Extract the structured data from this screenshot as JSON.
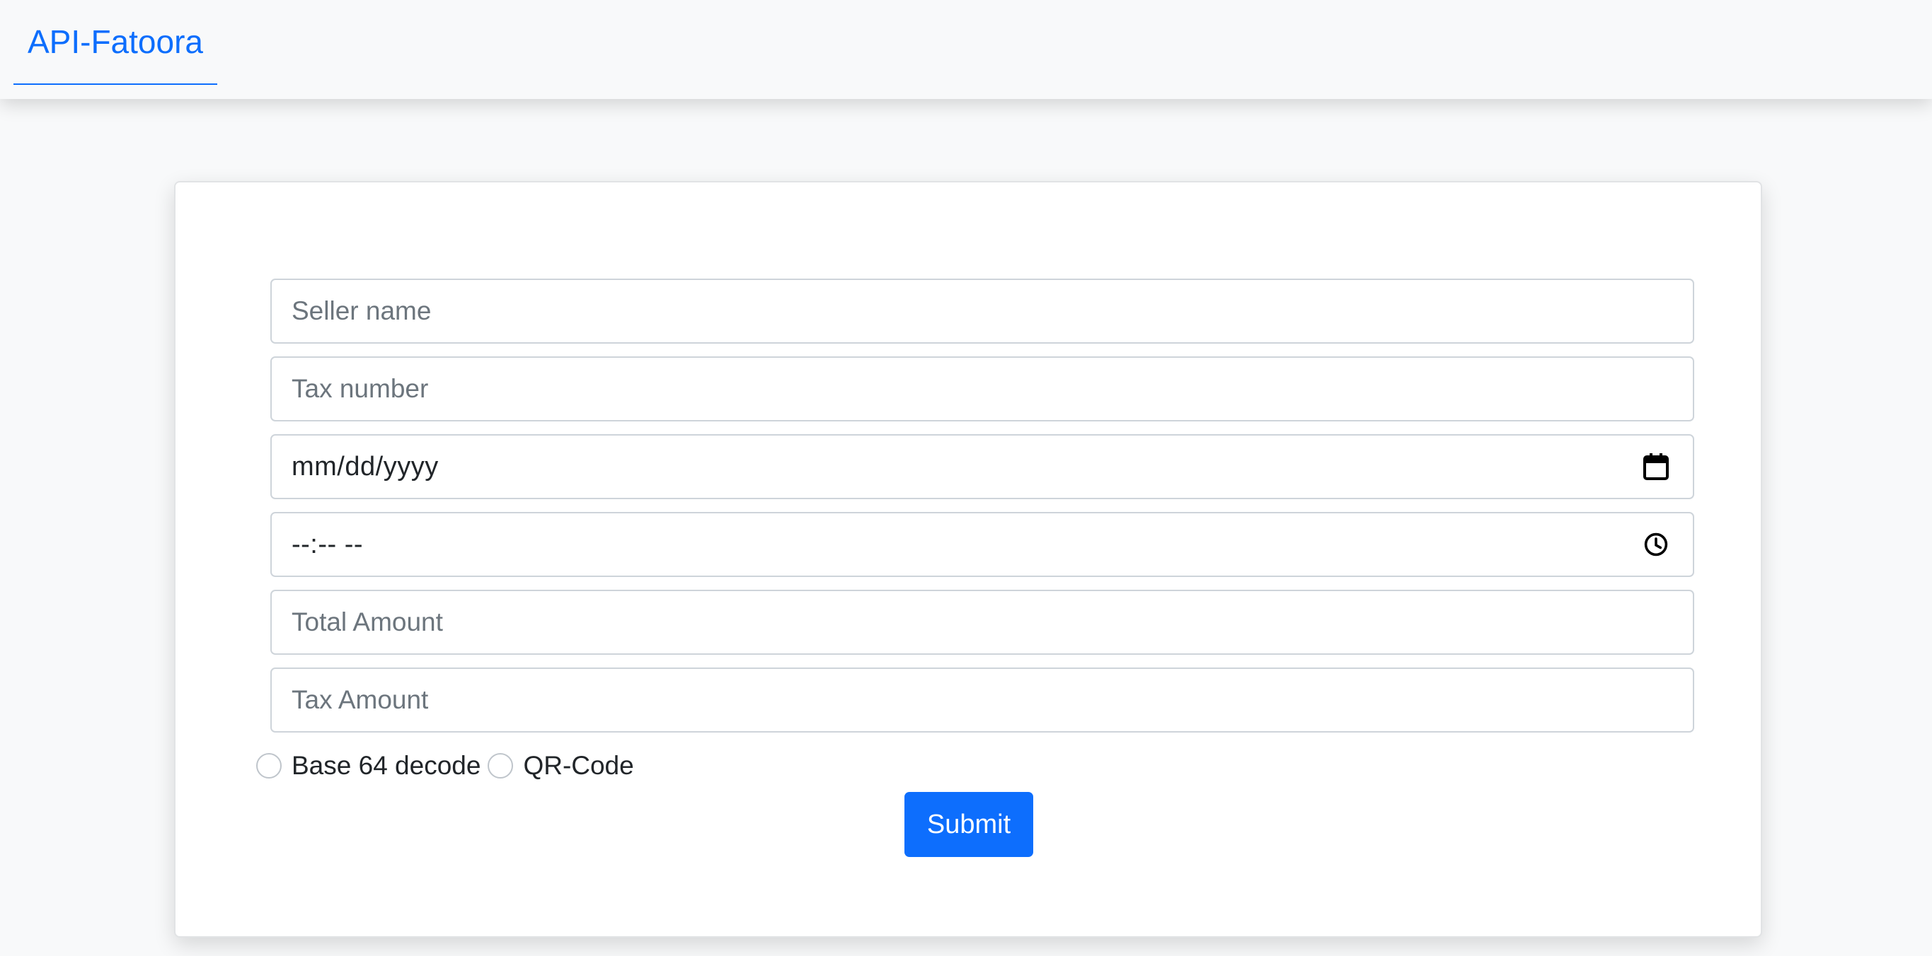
{
  "navbar": {
    "brand": "API-Fatoora",
    "colors": {
      "brand": "#0d6efd",
      "background": "#f8f9fa"
    }
  },
  "form": {
    "seller_name": {
      "placeholder": "Seller name",
      "value": ""
    },
    "tax_number": {
      "placeholder": "Tax number",
      "value": ""
    },
    "date": {
      "display": "mm/dd/yyyy",
      "icon": "calendar-icon"
    },
    "time": {
      "display": "--:-- --",
      "icon": "clock-icon"
    },
    "total_amount": {
      "placeholder": "Total Amount",
      "value": ""
    },
    "tax_amount": {
      "placeholder": "Tax Amount",
      "value": ""
    },
    "output_options": [
      {
        "label": "Base 64 decode",
        "selected": false
      },
      {
        "label": "QR-Code",
        "selected": false
      }
    ],
    "submit_label": "Submit",
    "colors": {
      "submit": "#0d6efd",
      "placeholder": "#6c757d",
      "border": "#ced4da"
    }
  }
}
